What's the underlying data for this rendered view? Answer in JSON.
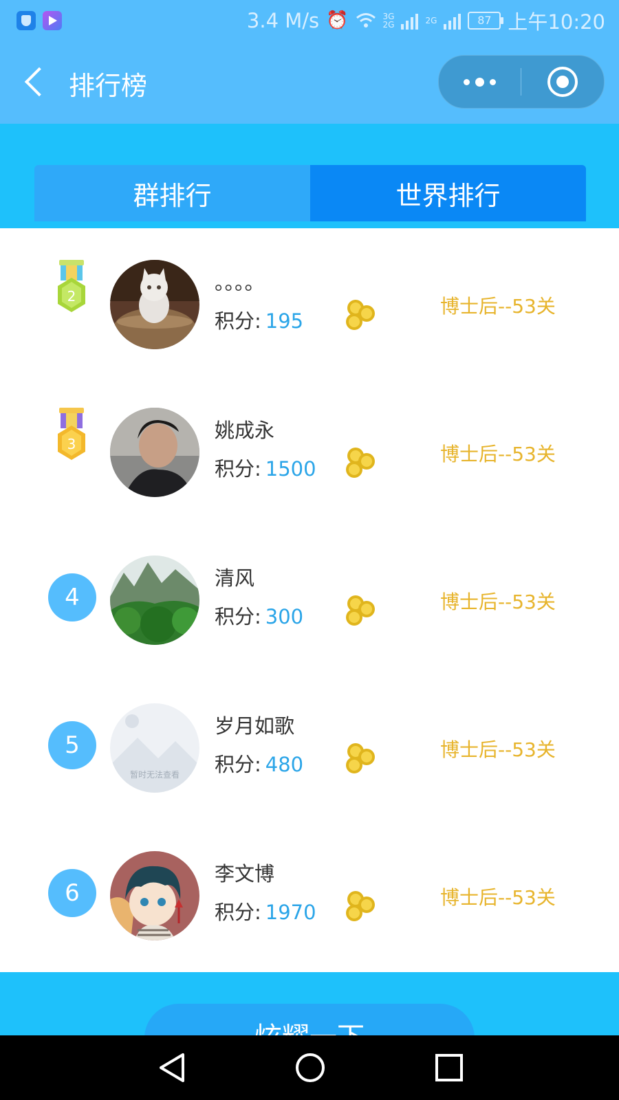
{
  "status_bar": {
    "speed": "3.4 M/s",
    "network_top": "3G",
    "network_bottom": "2G",
    "network_2g": "2G",
    "battery": "87",
    "time": "上午10:20",
    "icons": [
      "security-app-icon",
      "video-app-icon",
      "alarm-icon",
      "wifi-icon",
      "signal-icon",
      "battery-icon"
    ]
  },
  "header": {
    "title": "排行榜",
    "icons": [
      "back-chevron-icon",
      "more-dots-icon",
      "close-target-icon"
    ]
  },
  "tabs": [
    {
      "label": "群排行",
      "active": false
    },
    {
      "label": "世界排行",
      "active": true
    }
  ],
  "score_label": "积分:",
  "rankings": [
    {
      "rank": "2",
      "rank_display": "medal",
      "medal_color": "#a8d63a",
      "name": "。。。。",
      "score": "195",
      "level": "博士后--53关",
      "avatar": "cat-in-basket"
    },
    {
      "rank": "3",
      "rank_display": "medal",
      "medal_color": "#f3b82b",
      "name": "姚成永",
      "score": "1500",
      "level": "博士后--53关",
      "avatar": "man-portrait"
    },
    {
      "rank": "4",
      "rank_display": "circle",
      "name": "清风",
      "score": "300",
      "level": "博士后--53关",
      "avatar": "green-mountains"
    },
    {
      "rank": "5",
      "rank_display": "circle",
      "name": "岁月如歌",
      "score": "480",
      "level": "博士后--53关",
      "avatar": "placeholder-image",
      "avatar_text": "暂时无法查看"
    },
    {
      "rank": "6",
      "rank_display": "circle",
      "name": "李文博",
      "score": "1970",
      "level": "博士后--53关",
      "avatar": "anime-boy"
    }
  ],
  "share_button": {
    "label": "炫耀一下"
  },
  "colors": {
    "header_bg": "#55bdfd",
    "tab_band_bg": "#1ec1fb",
    "tab_inactive": "#2fa9f9",
    "tab_active": "#0a88f5",
    "score_value": "#2ba5e8",
    "level_text": "#e7b42c",
    "rank_circle": "#55bdfd"
  },
  "system_nav": {
    "icons": [
      "nav-back-icon",
      "nav-home-icon",
      "nav-recent-icon"
    ]
  }
}
